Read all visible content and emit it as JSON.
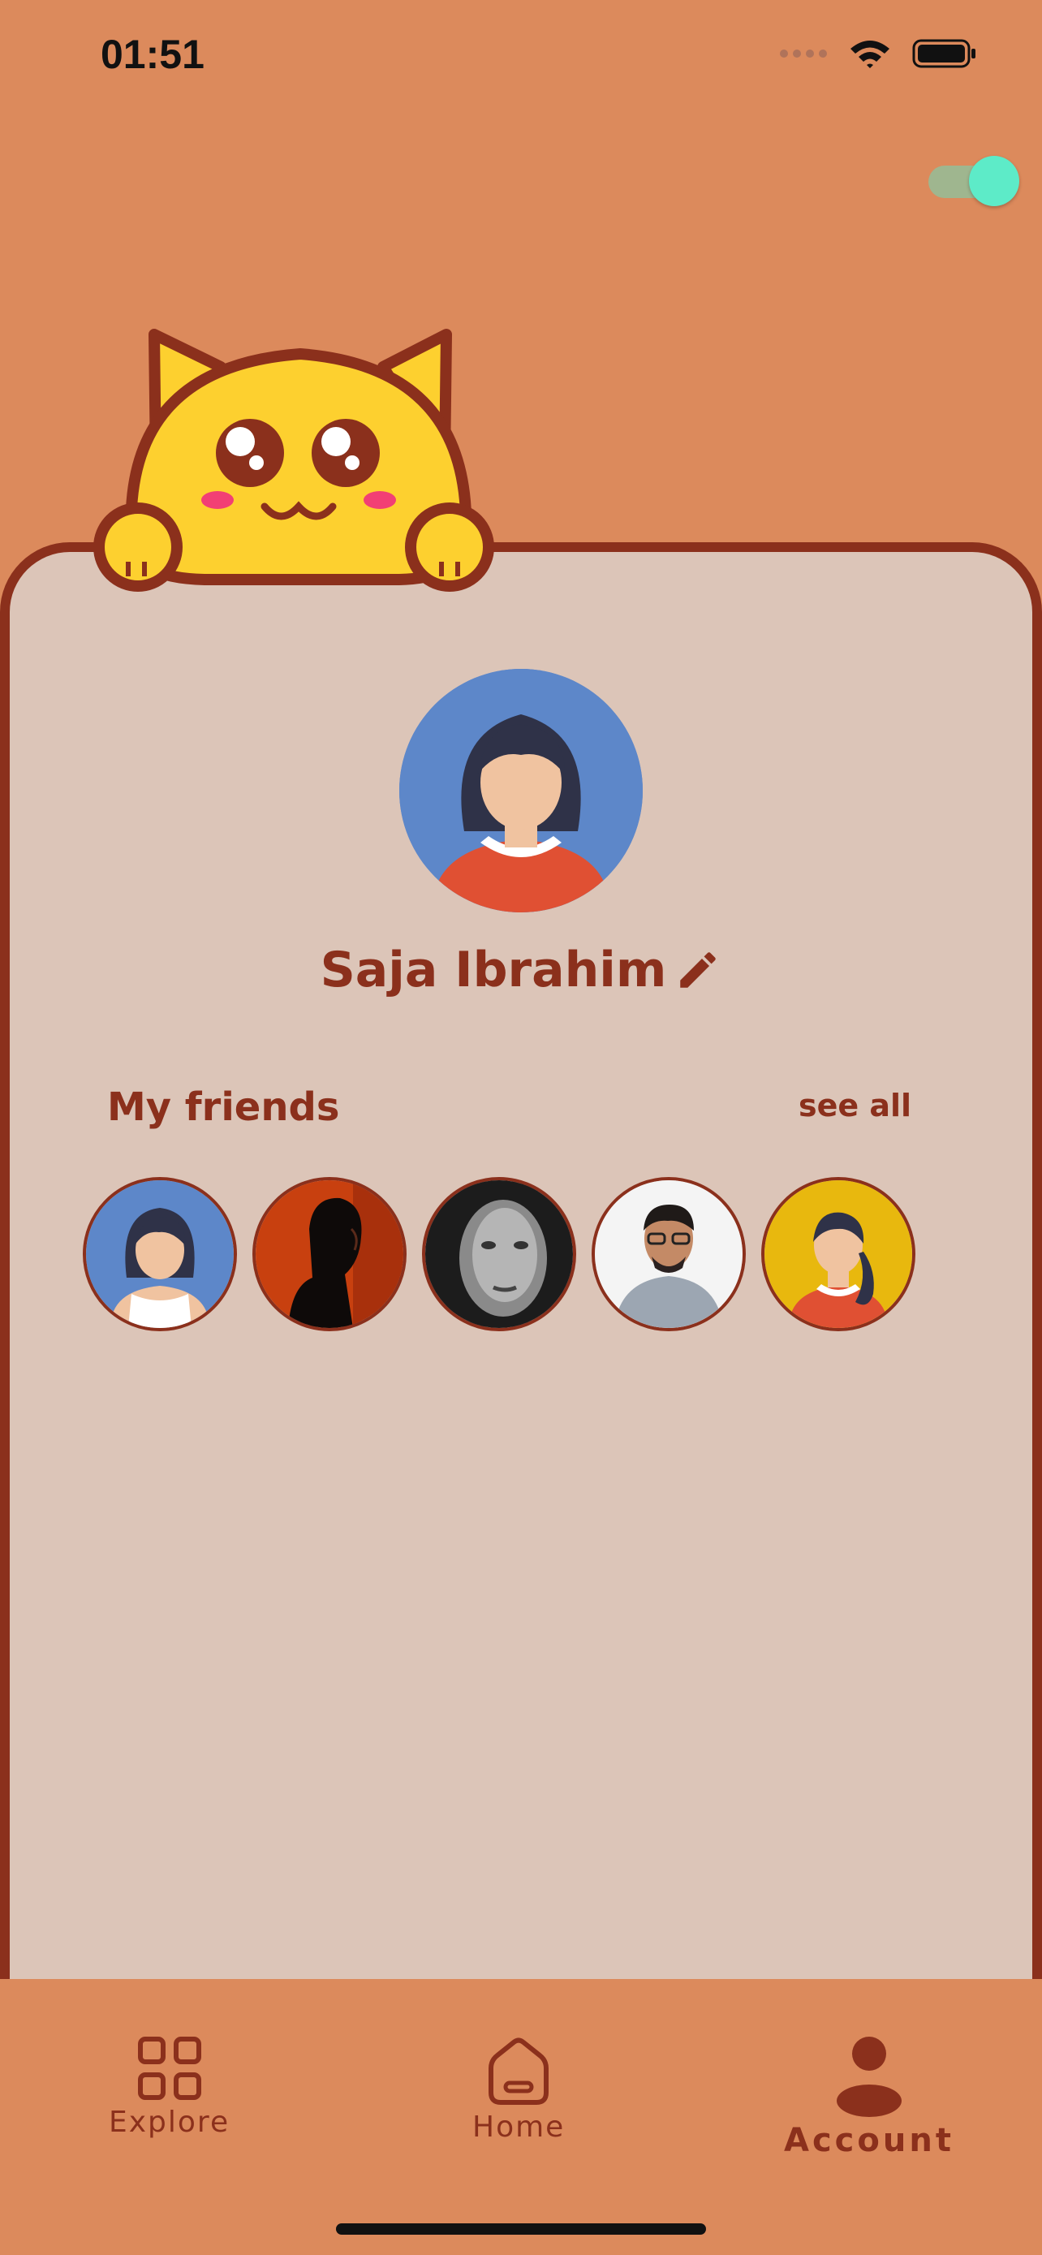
{
  "status_bar": {
    "time": "01:51"
  },
  "theme_toggle": {
    "state": "on",
    "colors": {
      "knob": "#5DEBC8",
      "track": "#9FB68F"
    }
  },
  "profile": {
    "name": "Saja Ibrahim",
    "edit_icon": "pencil-icon"
  },
  "friends": {
    "title": "My friends",
    "see_all_label": "see all",
    "items": [
      {
        "avatar": "woman-cartoon-blue"
      },
      {
        "avatar": "man-photo-dark-orange"
      },
      {
        "avatar": "woman-photo-grayscale"
      },
      {
        "avatar": "man-photo-glasses"
      },
      {
        "avatar": "woman-cartoon-yellow"
      }
    ]
  },
  "bottom_nav": {
    "items": [
      {
        "label": "Explore",
        "icon": "grid-icon",
        "active": false
      },
      {
        "label": "Home",
        "icon": "home-icon",
        "active": false
      },
      {
        "label": "Account",
        "icon": "person-icon",
        "active": true
      }
    ]
  },
  "colors": {
    "background": "#DC8A5C",
    "card": "#DCC5B8",
    "accent": "#8B301C",
    "mascot": "#FDD02F"
  }
}
